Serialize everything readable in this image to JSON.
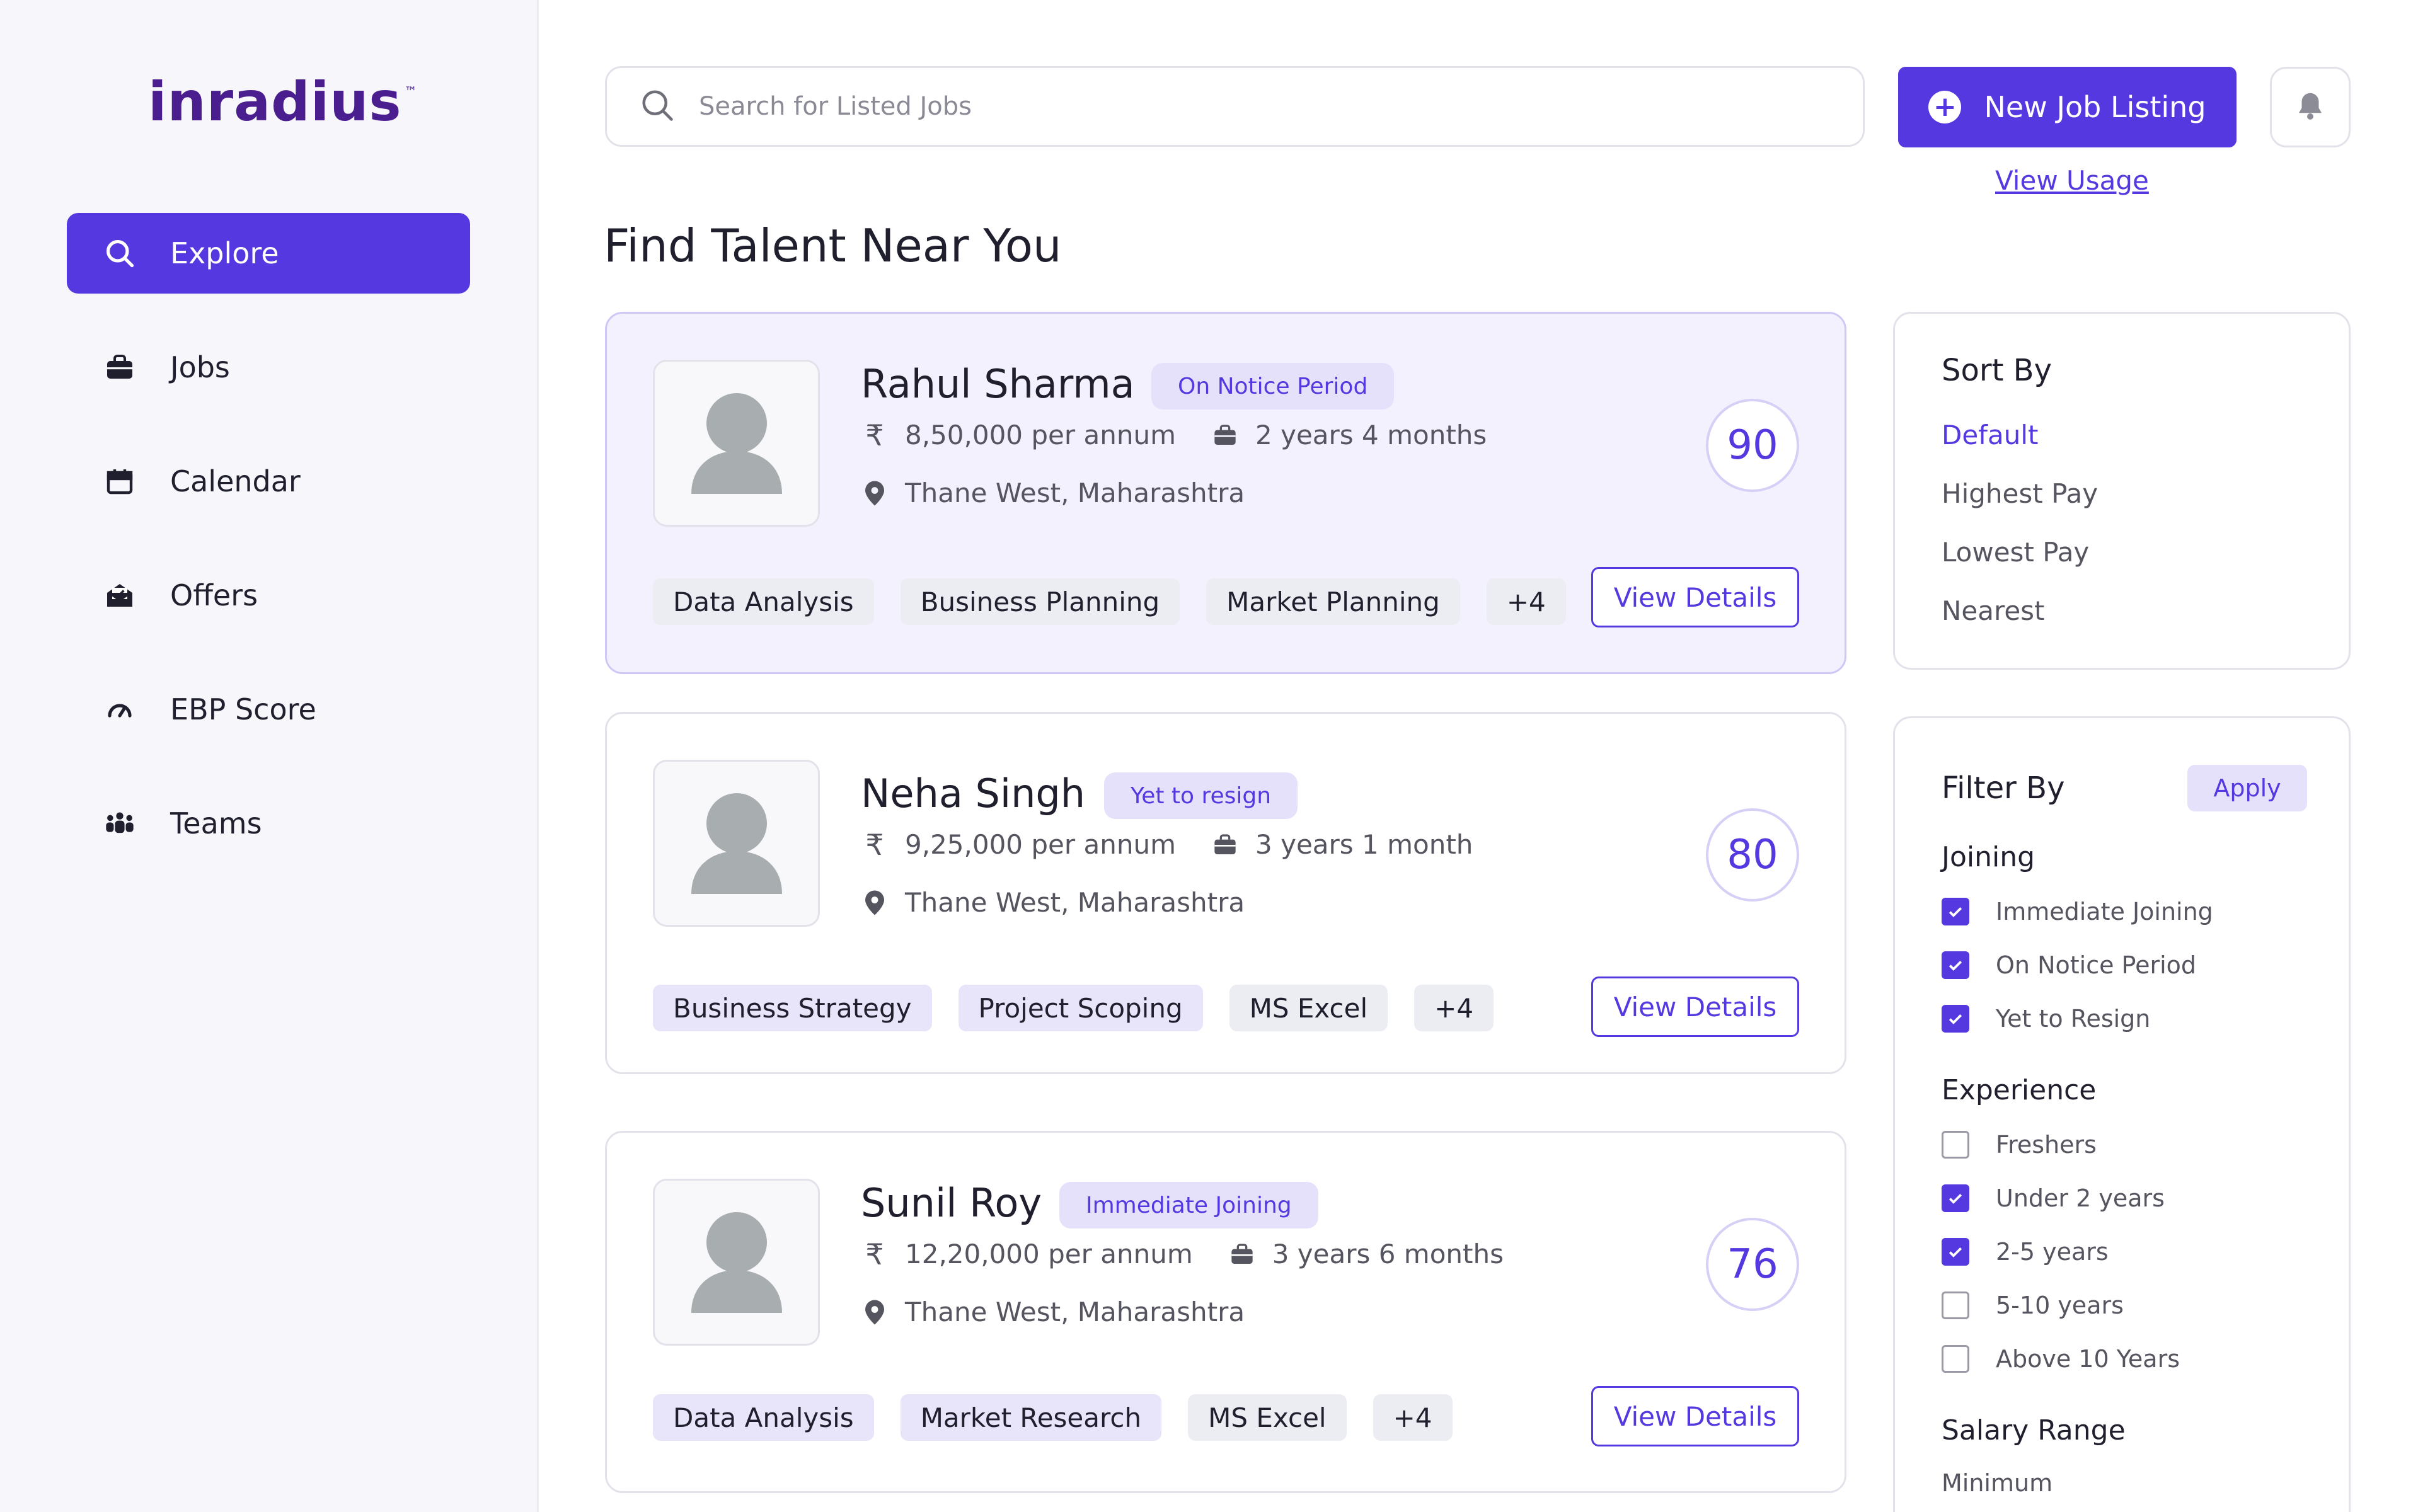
{
  "app": {
    "logo_text": "inradius",
    "logo_tm": "™"
  },
  "sidebar": {
    "items": [
      {
        "label": "Explore",
        "icon": "search-icon",
        "active": true
      },
      {
        "label": "Jobs",
        "icon": "briefcase-icon"
      },
      {
        "label": "Calendar",
        "icon": "calendar-icon"
      },
      {
        "label": "Offers",
        "icon": "mail-open-icon"
      },
      {
        "label": "EBP Score",
        "icon": "gauge-icon"
      },
      {
        "label": "Teams",
        "icon": "team-icon"
      }
    ]
  },
  "topbar": {
    "search_placeholder": "Search for Listed Jobs",
    "new_job_label": "New Job Listing",
    "view_usage_label": "View Usage"
  },
  "page": {
    "title": "Find Talent Near You"
  },
  "candidates": [
    {
      "name": "Rahul Sharma",
      "status": "On Notice Period",
      "salary": "8,50,000 per annum",
      "experience": "2 years 4 months",
      "location": "Thane West, Maharashtra",
      "score": "90",
      "tags": [
        "Data Analysis",
        "Business Planning",
        "Market Planning",
        "+4"
      ],
      "details_label": "View Details"
    },
    {
      "name": "Neha Singh",
      "status": "Yet to resign",
      "salary": "9,25,000 per annum",
      "experience": "3 years 1 month",
      "location": "Thane West, Maharashtra",
      "score": "80",
      "tags": [
        "Business Strategy",
        "Project Scoping",
        "MS Excel",
        "+4"
      ],
      "details_label": "View Details"
    },
    {
      "name": "Sunil Roy",
      "status": "Immediate Joining",
      "salary": "12,20,000 per annum",
      "experience": "3 years 6 months",
      "location": "Thane West, Maharashtra",
      "score": "76",
      "tags": [
        "Data Analysis",
        "Market Research",
        "MS Excel",
        "+4"
      ],
      "details_label": "View Details"
    }
  ],
  "sort": {
    "title": "Sort By",
    "options": [
      "Default",
      "Highest Pay",
      "Lowest Pay",
      "Nearest"
    ],
    "selected": "Default"
  },
  "filter": {
    "title": "Filter By",
    "apply_label": "Apply",
    "joining": {
      "title": "Joining",
      "options": [
        {
          "label": "Immediate Joining",
          "checked": true
        },
        {
          "label": "On Notice Period",
          "checked": true
        },
        {
          "label": "Yet to Resign",
          "checked": true
        }
      ]
    },
    "experience": {
      "title": "Experience",
      "options": [
        {
          "label": "Freshers",
          "checked": false
        },
        {
          "label": "Under 2 years",
          "checked": true
        },
        {
          "label": "2-5 years",
          "checked": true
        },
        {
          "label": "5-10 years",
          "checked": false
        },
        {
          "label": "Above 10 Years",
          "checked": false
        }
      ]
    },
    "salary": {
      "title": "Salary Range",
      "minimum_label": "Minimum"
    }
  },
  "colors": {
    "accent": "#5538E0",
    "accent_soft": "#E6E1FB",
    "logo": "#4B1E8F",
    "logo_dot": "#E8532E"
  }
}
